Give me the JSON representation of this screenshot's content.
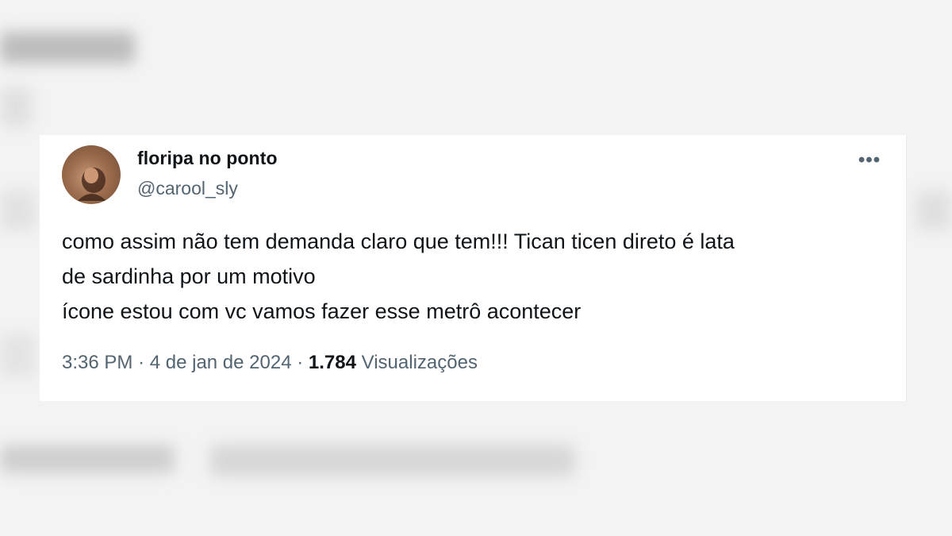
{
  "tweet": {
    "display_name": "floripa no ponto",
    "handle": "@carool_sly",
    "more_icon": "more-horizontal-icon",
    "lines": [
      "como assim não tem demanda claro que tem!!! Tican ticen direto é lata",
      "de sardinha por um motivo",
      "ícone estou com vc vamos fazer esse metrô acontecer"
    ],
    "time": "3:36 PM",
    "separator": "·",
    "date": "4 de jan de 2024",
    "views_count": "1.784",
    "views_label": "Visualizações"
  },
  "colors": {
    "text_primary": "#0f1419",
    "text_secondary": "#536471",
    "card_bg": "#ffffff",
    "page_bg": "#f3f3f3"
  }
}
